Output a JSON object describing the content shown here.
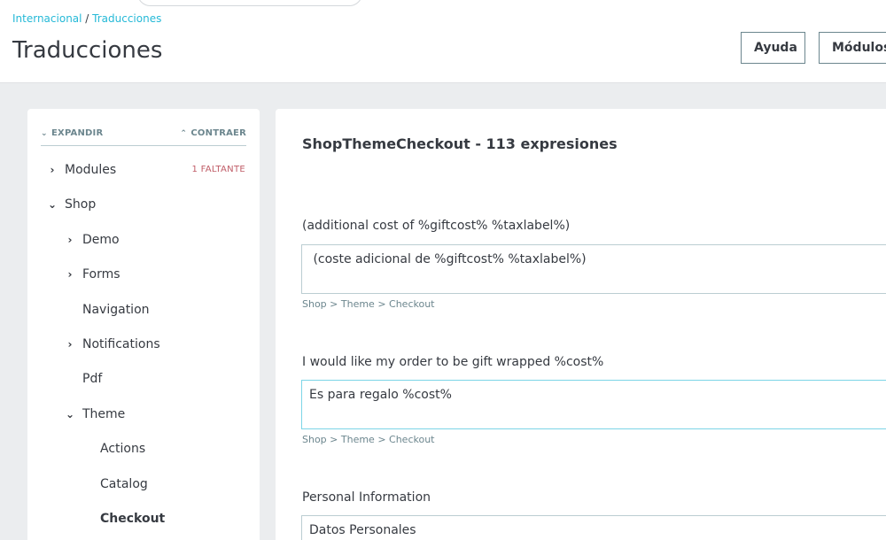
{
  "breadcrumb": {
    "parent": "Internacional",
    "separator": " / ",
    "current": "Traducciones"
  },
  "header": {
    "title": "Traducciones",
    "help_label": "Ayuda",
    "modules_label": "Módulos"
  },
  "sidebar": {
    "expand_label": "EXPANDIR",
    "collapse_label": "CONTRAER",
    "expand_icon": "chevron-down-icon",
    "collapse_icon": "chevron-up-icon",
    "missing_badge": "1 FALTANTE",
    "nodes": {
      "modules": "Modules",
      "shop": "Shop",
      "demo": "Demo",
      "forms": "Forms",
      "navigation": "Navigation",
      "notifications": "Notifications",
      "pdf": "Pdf",
      "theme": "Theme",
      "actions": "Actions",
      "catalog": "Catalog",
      "checkout": "Checkout"
    }
  },
  "main": {
    "title": "ShopThemeCheckout - 113 expresiones",
    "entries": [
      {
        "source": "(additional cost of %giftcost% %taxlabel%)",
        "translation": " (coste adicional de %giftcost% %taxlabel%)",
        "path": "Shop > Theme > Checkout"
      },
      {
        "source": "I would like my order to be gift wrapped %cost%",
        "translation": "Es para regalo %cost%",
        "path": "Shop > Theme > Checkout"
      },
      {
        "source": "Personal Information",
        "translation": "Datos Personales"
      }
    ]
  },
  "colors": {
    "accent": "#25b9d7",
    "badge": "#c05c67",
    "text": "#363a41",
    "muted": "#6c868e",
    "background": "#ebedef"
  }
}
